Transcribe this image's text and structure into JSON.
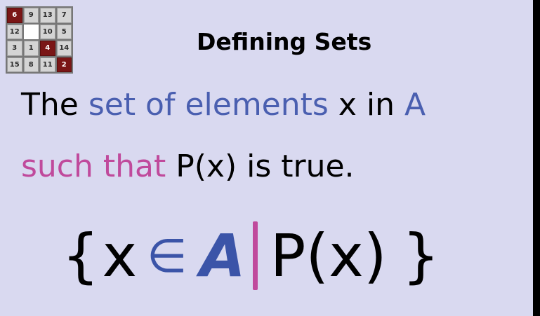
{
  "logo": {
    "tiles": [
      "6",
      "9",
      "13",
      "7",
      "12",
      "",
      "10",
      "5",
      "3",
      "1",
      "4",
      "14",
      "15",
      "8",
      "11",
      "2"
    ]
  },
  "title": "Defining Sets",
  "line1": {
    "part1": "The ",
    "part2": "set of elements",
    "part3": " x in ",
    "part4": "A"
  },
  "line2": {
    "part1": "such that",
    "part2": " P(x) is true."
  },
  "formula": {
    "open_brace": "{",
    "x": "x",
    "element_of": "∈",
    "set": "A",
    "predicate": "P(x)",
    "close_brace": "}"
  },
  "colors": {
    "background": "#d9d9f0",
    "blue_text": "#4a5fb0",
    "pink_text": "#c04a9c",
    "tile_red": "#7a1616"
  }
}
